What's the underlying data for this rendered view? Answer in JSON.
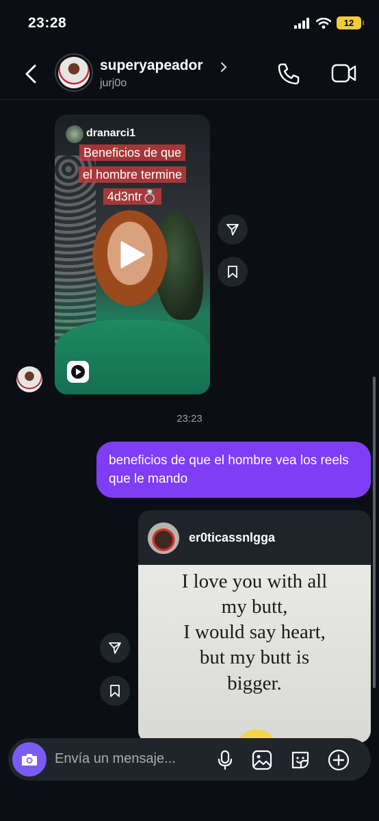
{
  "status_bar": {
    "time": "23:28",
    "battery": "12"
  },
  "header": {
    "username": "superyapeador",
    "handle": "jurj0o"
  },
  "messages": {
    "reel1": {
      "owner": "dranarci1",
      "caption_lines": [
        "Beneficios de que",
        "el hombre termine",
        "4d3ntr💍"
      ]
    },
    "timestamp": "23:23",
    "sent_text": "beneficios de que el hombre vea los reels que le mando",
    "reel2": {
      "owner": "er0ticassnlgga",
      "quote_lines": [
        "I love you with all",
        "my butt,",
        "I would say heart,",
        "but my butt is",
        "bigger."
      ]
    }
  },
  "composer": {
    "placeholder": "Envía un mensaje..."
  },
  "colors": {
    "accent": "#7f3df5",
    "camera": "#7a5cf5",
    "background": "#0b0f14",
    "battery": "#f2cb3b"
  },
  "icons": [
    "back-icon",
    "chevron-right-icon",
    "phone-icon",
    "video-icon",
    "play-icon",
    "reel-icon",
    "share-icon",
    "bookmark-icon",
    "camera-icon",
    "mic-icon",
    "gallery-icon",
    "sticker-icon",
    "plus-icon",
    "signal-icon",
    "wifi-icon"
  ]
}
